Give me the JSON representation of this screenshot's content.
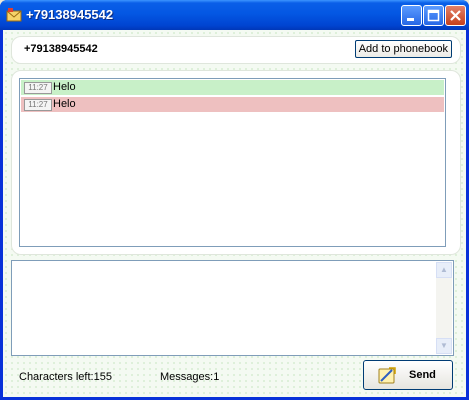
{
  "window": {
    "title": "+79138945542",
    "icons": {
      "app": "envelope-icon",
      "minimize": "minimize-icon",
      "maximize": "maximize-icon",
      "close": "close-icon"
    }
  },
  "header": {
    "phone": "+79138945542",
    "add_button_label": "Add to phonebook"
  },
  "messages": [
    {
      "time": "11:27",
      "text": "Helo",
      "direction": "incoming",
      "color": "#c8f0c8"
    },
    {
      "time": "11:27",
      "text": "Helo",
      "direction": "outgoing",
      "color": "#eec0c0"
    }
  ],
  "compose": {
    "value": ""
  },
  "status": {
    "characters_left": "Characters left:155",
    "messages_count": "Messages:1"
  },
  "send_button": {
    "label": "Send",
    "icon": "send-sms-icon"
  }
}
